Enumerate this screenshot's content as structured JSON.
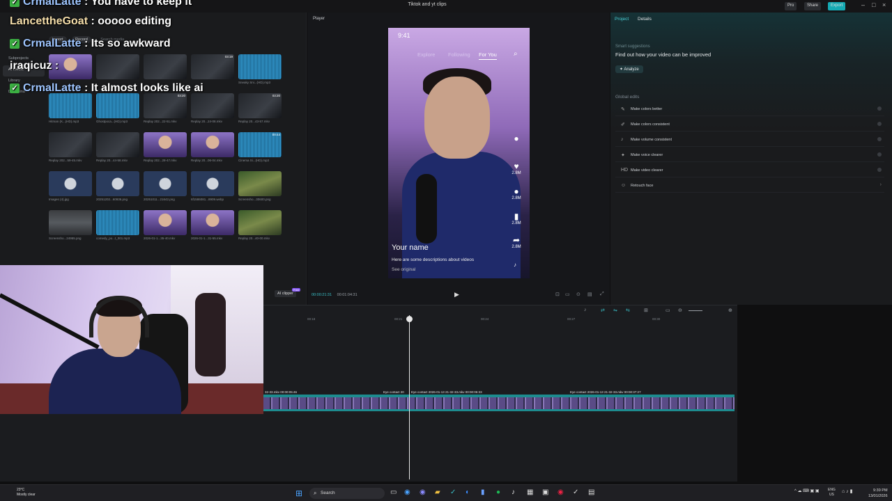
{
  "window": {
    "title": "Tiktok and yt clips",
    "pro_label": "Pro",
    "share_label": "Share",
    "export_label": "Export"
  },
  "media": {
    "import_label": "Import",
    "record_label": "Record",
    "search_placeholder": "Search media",
    "sidebar": [
      "Subprojects",
      "AI media",
      "Library",
      "Dreamina"
    ],
    "tiles": [
      {
        "kind": "person",
        "duration": "",
        "caption": ""
      },
      {
        "kind": "replay",
        "duration": "",
        "caption": ""
      },
      {
        "kind": "replay",
        "duration": "",
        "caption": ""
      },
      {
        "kind": "replay",
        "duration": "03:19",
        "caption": ""
      },
      {
        "kind": "audio",
        "duration": "",
        "caption": "Sneaky Sni...(HD).mp3"
      },
      {
        "kind": "audio",
        "duration": "",
        "caption": "Hitman (K...(HD).mp3"
      },
      {
        "kind": "audio",
        "duration": "",
        "caption": "Ghostpoca...(HD).mp3"
      },
      {
        "kind": "replay",
        "duration": "03:20",
        "caption": "Replay 202...22-51.mkv"
      },
      {
        "kind": "replay",
        "duration": "",
        "caption": "Replay 20...24-08.mkv"
      },
      {
        "kind": "replay",
        "duration": "03:20",
        "caption": "Replay 20...43-57.mkv"
      },
      {
        "kind": "replay",
        "duration": "",
        "caption": "Replay 202...59-45.mkv"
      },
      {
        "kind": "replay",
        "duration": "",
        "caption": "Replay 20...44-58.mkv"
      },
      {
        "kind": "person",
        "duration": "",
        "caption": "Replay 202...28-47.mkv"
      },
      {
        "kind": "person",
        "duration": "",
        "caption": "Replay 20...06-04.mkv"
      },
      {
        "kind": "audio",
        "duration": "00:44",
        "caption": "Cinema Si...(HD).mp3"
      },
      {
        "kind": "image",
        "duration": "",
        "caption": "Images (4).jpg"
      },
      {
        "kind": "image",
        "duration": "",
        "caption": "20251202...60936.png"
      },
      {
        "kind": "image",
        "duration": "",
        "caption": "20251011...21642.png"
      },
      {
        "kind": "image",
        "duration": "",
        "caption": "6f1586081...8909.webp"
      },
      {
        "kind": "game",
        "duration": "",
        "caption": "Screensho...30600.png"
      },
      {
        "kind": "gray",
        "duration": "",
        "caption": "Screensho...24955.png"
      },
      {
        "kind": "audio",
        "duration": "",
        "caption": "comedy_po...t_001.mp3"
      },
      {
        "kind": "person",
        "duration": "",
        "caption": "2026-01-1...35-40.mkv"
      },
      {
        "kind": "person",
        "duration": "",
        "caption": "2026-01-1...31-55.mkv"
      },
      {
        "kind": "game",
        "duration": "",
        "caption": "Replay 20...40-00.mkv"
      }
    ]
  },
  "chat": [
    {
      "user": "CrmalLatte",
      "message": "You have to keep it",
      "color": "#9ec5ff",
      "badge": true
    },
    {
      "user": "LancettheGoat",
      "message": "ooooo editing",
      "color": "#f5deaa",
      "badge": false
    },
    {
      "user": "CrmalLatte",
      "message": "Its so awkward",
      "color": "#9ec5ff",
      "badge": true
    },
    {
      "user": "iraqicuz",
      "message": "",
      "color": "#ffffff",
      "badge": false
    },
    {
      "user": "CrmalLatte",
      "message": "It almost looks like ai",
      "color": "#9ec5ff",
      "badge": true
    }
  ],
  "player": {
    "label": "Player",
    "phone": {
      "clock": "9:41",
      "tabs": [
        "Explore",
        "Following",
        "For You"
      ],
      "stats": [
        "2.8M",
        "2.8M",
        "2.8M",
        "2.8M"
      ],
      "name": "Your name",
      "description": "Here are some descriptions about videos",
      "see_original": "See original"
    },
    "time_current": "00:00:21:31",
    "time_total": "00:01:04:31",
    "ai_clipper": "AI clipper",
    "new_tag": "Free"
  },
  "props": {
    "tab_project": "Project",
    "tab_details": "Details",
    "smart_title": "Smart suggestions",
    "smart_desc": "Find out how your video can be improved",
    "analyze_label": "Analyze",
    "global_title": "Global edits",
    "edits": [
      {
        "label": "Make colors better",
        "icon": "✎"
      },
      {
        "label": "Make colors consistent",
        "icon": "✐"
      },
      {
        "label": "Make volume consistent",
        "icon": "♪"
      },
      {
        "label": "Make voice clearer",
        "icon": "✦"
      },
      {
        "label": "Make video clearer",
        "icon": "HD"
      },
      {
        "label": "Retouch face",
        "icon": "☺"
      }
    ]
  },
  "timeline": {
    "ruler": [
      "00:18",
      "00:21",
      "00:24",
      "00:27",
      "00:30"
    ],
    "clips": [
      {
        "label": "32-33.mkv  00:00:05:46"
      },
      {
        "label": "Eye contact  20"
      },
      {
        "label": "Eye contact  2026-01-13 21-32-33.mkv  00:00:05:33"
      },
      {
        "label": "Eye contact  2026-01-13 21-32-33.mkv  00:00:37:27"
      }
    ]
  },
  "taskbar": {
    "temp": "23°C",
    "weather": "Mostly clear",
    "search": "Search",
    "lang_top": "ENG",
    "lang_bottom": "US",
    "time": "9:39 PM",
    "date": "13/01/2026"
  }
}
